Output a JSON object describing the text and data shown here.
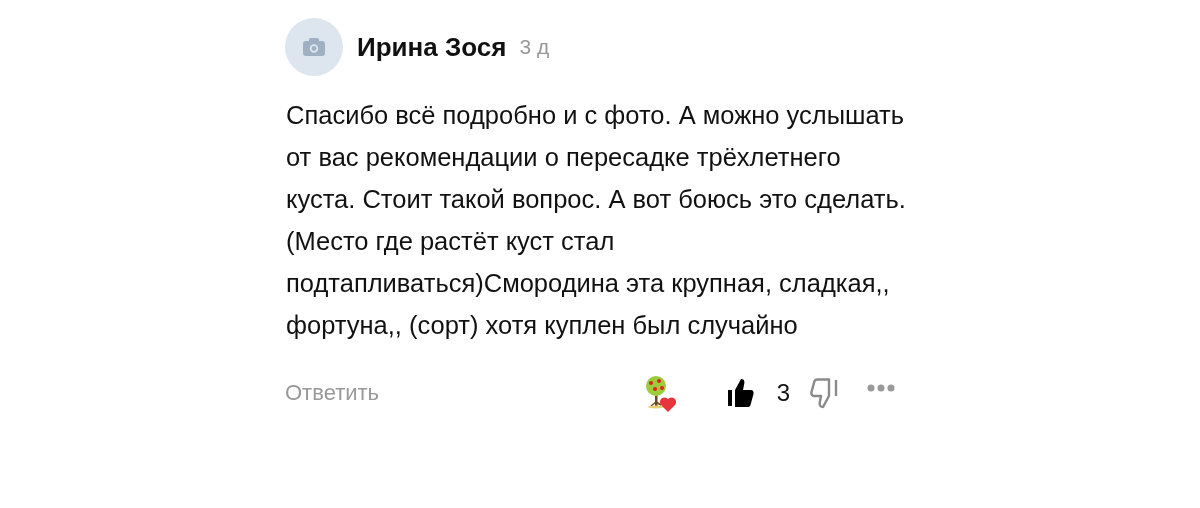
{
  "comment": {
    "author": "Ирина Зося",
    "time": "3 д",
    "text": "Спасибо всё подробно и с фото. А можно услышать от вас рекомендации о пересадке трёхлетнего куста. Стоит такой вопрос. А вот боюсь это сделать. (Место где растёт куст стал подтапливаться)Смородина эта крупная, сладкая,, фортуна,, (сорт) хотя куплен был случайно",
    "reply": "Ответить",
    "likes": "3",
    "liked": true,
    "disliked": false
  }
}
